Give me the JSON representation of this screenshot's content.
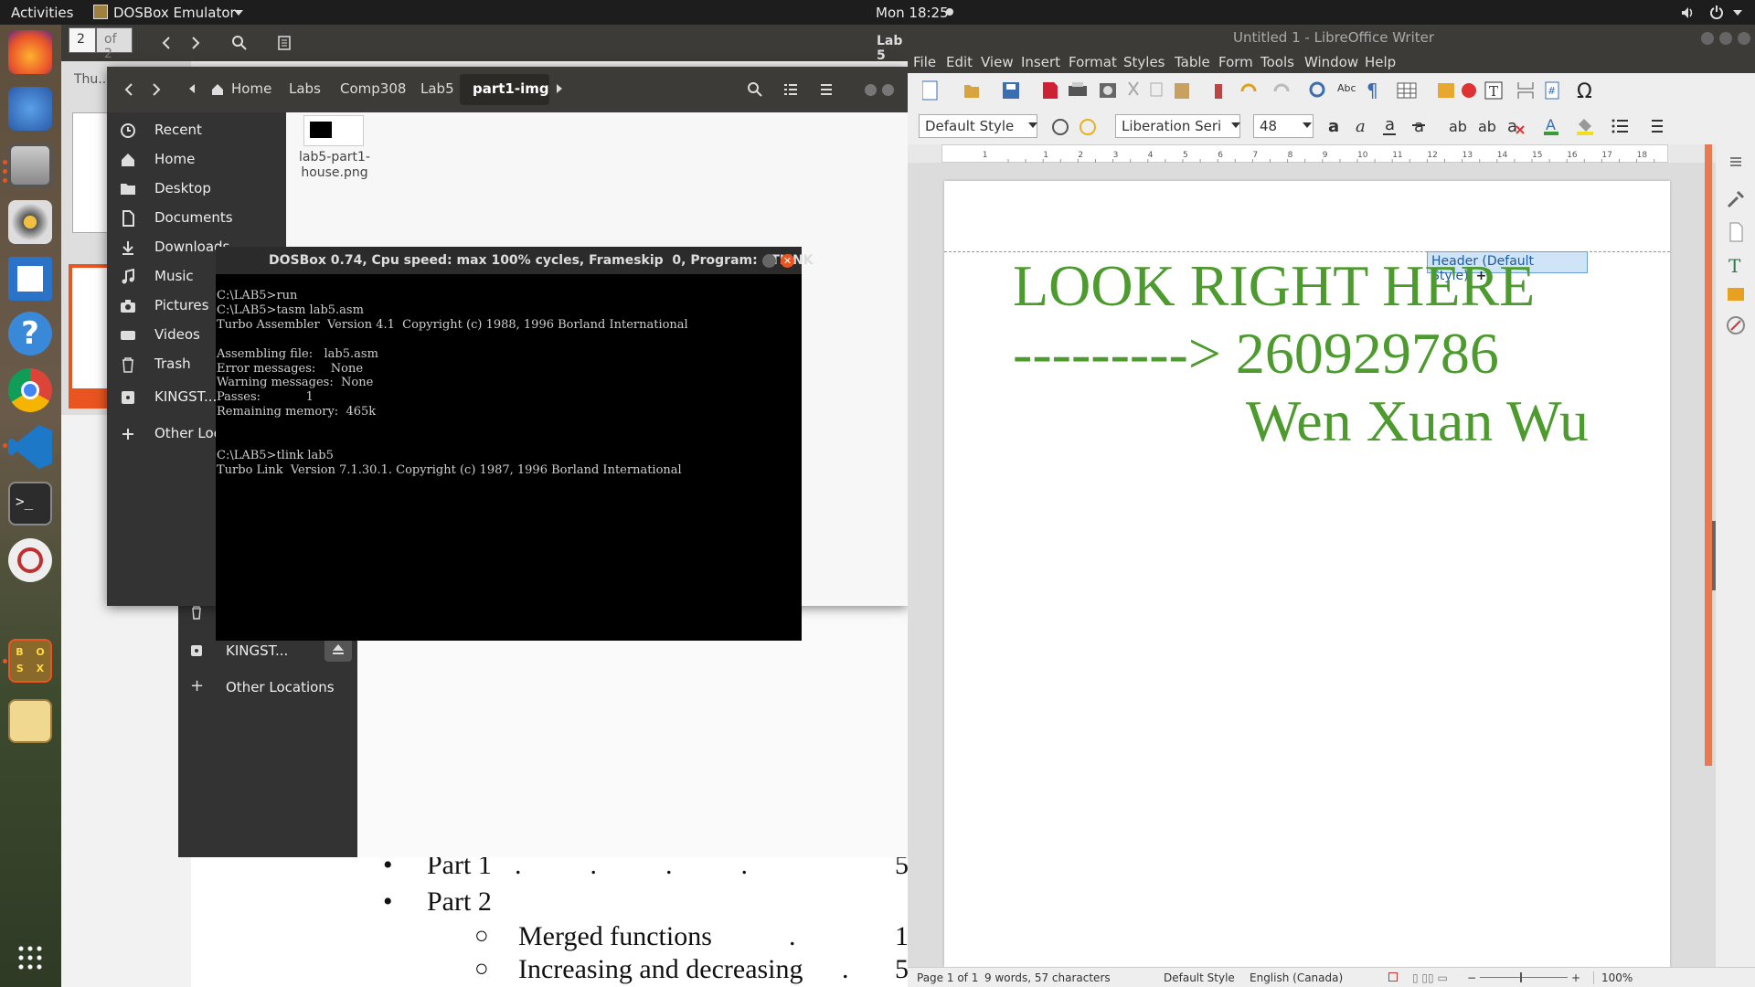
{
  "topbar": {
    "activities": "Activities",
    "app_name": "DOSBox Emulator",
    "clock": "Mon 18:25"
  },
  "dock": {
    "apps": [
      "firefox-icon",
      "thunderbird-icon",
      "files-icon",
      "rhythmbox-icon",
      "writer-icon",
      "help-icon",
      "chrome-icon",
      "vscode-icon",
      "terminal-icon",
      "libreoffice-impress-icon",
      "dosbox-icon",
      "text-editor-icon",
      "app-grid-icon"
    ],
    "dosbox_label": "B O S X"
  },
  "viewer": {
    "page_num": "2",
    "page_of": "of 2",
    "title_fragment": "Lab 5",
    "thumb_label": "Thu...",
    "doc_lines": [
      {
        "bullet": "•",
        "text": "Part 1",
        "dots": ".          .          .          .",
        "page": "5"
      },
      {
        "bullet": "•",
        "text": "Part 2",
        "dots": "",
        "page": ""
      },
      {
        "bullet": "○",
        "text": "Merged functions",
        "dots": ".",
        "page": "1"
      },
      {
        "bullet": "○",
        "text": "Increasing and decreasing",
        "dots": ".",
        "page": "5"
      }
    ]
  },
  "nautilus_back": {
    "drive_label": "KINGST...",
    "other_locations": "Other Locations"
  },
  "nautilus": {
    "breadcrumbs": [
      "Home",
      "Labs",
      "Comp308",
      "Lab5",
      "part1-img"
    ],
    "sidebar": [
      {
        "label": "Recent",
        "icon": "clock-icon"
      },
      {
        "label": "Home",
        "icon": "home-icon"
      },
      {
        "label": "Desktop",
        "icon": "folder-icon"
      },
      {
        "label": "Documents",
        "icon": "document-icon"
      },
      {
        "label": "Downloads",
        "icon": "download-icon"
      },
      {
        "label": "Music",
        "icon": "music-icon"
      },
      {
        "label": "Pictures",
        "icon": "camera-icon"
      },
      {
        "label": "Videos",
        "icon": "video-icon"
      },
      {
        "label": "Trash",
        "icon": "trash-icon"
      },
      {
        "label": "KINGST...",
        "icon": "drive-icon"
      },
      {
        "label": "Other Loca",
        "icon": "plus-icon"
      }
    ],
    "file_name": "lab5-part1-house.png",
    "file_name_l1": "lab5-part1-",
    "file_name_l2": "house.png"
  },
  "dosbox": {
    "title": "DOSBox 0.74, Cpu speed: max 100% cycles, Frameskip  0, Program:   TLINK",
    "screen": "C:\\LAB5>run\nC:\\LAB5>tasm lab5.asm\nTurbo Assembler  Version 4.1  Copyright (c) 1988, 1996 Borland International\n\nAssembling file:   lab5.asm\nError messages:    None\nWarning messages:  None\nPasses:            1\nRemaining memory:  465k\n\n\nC:\\LAB5>tlink lab5\nTurbo Link  Version 7.1.30.1. Copyright (c) 1987, 1996 Borland International"
  },
  "writer": {
    "title": "Untitled 1 - LibreOffice Writer",
    "menu": [
      "File",
      "Edit",
      "View",
      "Insert",
      "Format",
      "Styles",
      "Table",
      "Form",
      "Tools",
      "Window",
      "Help"
    ],
    "para_style": "Default Style",
    "font_name": "Liberation Seri",
    "font_size": "48",
    "header_tag": "Header (Default Style)",
    "header_plus": "+",
    "lines": [
      "LOOK RIGHT HERE",
      "---------> 260929786",
      "Wen Xuan Wu"
    ],
    "text_color": "#4d9a2e",
    "ruler_nums": [
      "1",
      "1",
      "2",
      "3",
      "4",
      "5",
      "6",
      "7",
      "8",
      "9",
      "10",
      "11",
      "12",
      "13",
      "14",
      "15",
      "16",
      "17",
      "18"
    ],
    "status": {
      "page": "Page 1 of 1",
      "words": "9 words, 57 characters",
      "style": "Default Style",
      "lang": "English (Canada)",
      "zoom": "100%"
    }
  }
}
